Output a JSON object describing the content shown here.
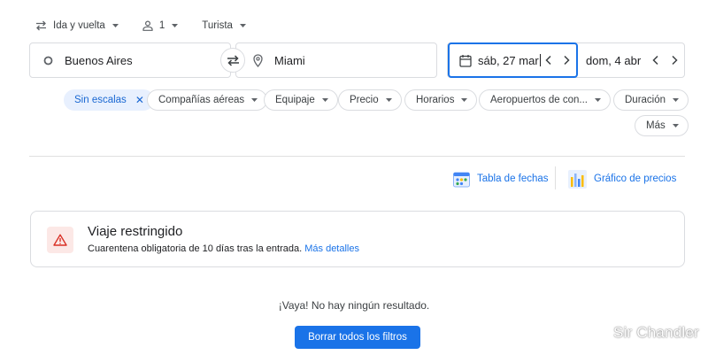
{
  "options": {
    "trip_type": "Ida y vuelta",
    "passengers": "1",
    "cabin": "Turista"
  },
  "search": {
    "origin": "Buenos Aires",
    "destination": "Miami",
    "depart_date": "sáb, 27 mar",
    "return_date": "dom, 4 abr"
  },
  "filters": [
    {
      "label": "Sin escalas",
      "active": true
    },
    {
      "label": "Compañías aéreas"
    },
    {
      "label": "Equipaje"
    },
    {
      "label": "Precio"
    },
    {
      "label": "Horarios"
    },
    {
      "label": "Aeropuertos de con..."
    },
    {
      "label": "Duración"
    },
    {
      "label": "Más"
    }
  ],
  "tools": {
    "date_grid": "Tabla de fechas",
    "price_graph": "Gráfico de precios"
  },
  "restriction": {
    "title": "Viaje restringido",
    "body": "Cuarentena obligatoria de 10 días tras la entrada.",
    "link": "Más detalles"
  },
  "empty_state": {
    "message": "¡Vaya! No hay ningún resultado.",
    "button": "Borrar todos los filtros"
  },
  "watermark": "Sir Chandler",
  "colors": {
    "accent": "#1a73e8",
    "active_chip_bg": "#e8f0fe",
    "warning": "#d93025",
    "warning_bg": "#fce8e6"
  }
}
